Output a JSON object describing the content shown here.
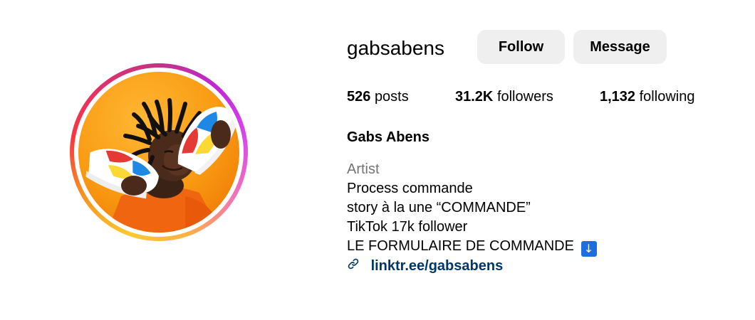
{
  "profile": {
    "username": "gabsabens",
    "full_name": "Gabs Abens",
    "avatar_alt": "Profile picture"
  },
  "actions": {
    "follow_label": "Follow",
    "message_label": "Message"
  },
  "stats": {
    "posts_count": "526",
    "posts_label": "posts",
    "followers_count": "31.2K",
    "followers_label": "followers",
    "following_count": "1,132",
    "following_label": "following"
  },
  "bio": {
    "category": "Artist",
    "lines": [
      "Process commande",
      "story à la une “COMMANDE”",
      "TikTok 17k follower",
      "LE FORMULAIRE DE COMMANDE"
    ],
    "arrow_emoji": "↓",
    "link_text": "linktr.ee/gabsabens",
    "link_icon": "link-icon"
  },
  "colors": {
    "button_bg": "#efefef",
    "link_color": "#00376b",
    "category_color": "#737373",
    "ring_gradient": [
      "#fdc830",
      "#f7931e",
      "#e1306c",
      "#c026d3"
    ]
  }
}
